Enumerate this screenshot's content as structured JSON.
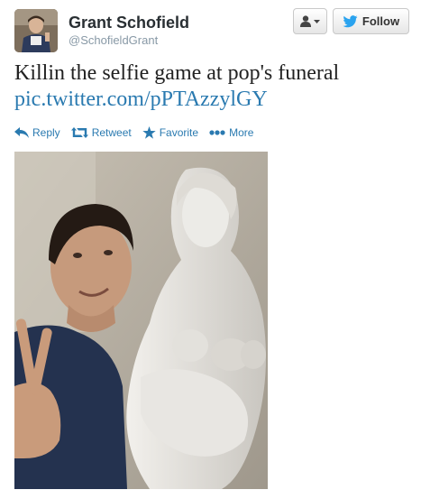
{
  "user": {
    "full_name": "Grant Schofield",
    "username": "@SchofieldGrant"
  },
  "header": {
    "user_dropdown_icon": "person-icon",
    "follow_label": "Follow",
    "follow_icon": "twitter-bird-icon"
  },
  "tweet": {
    "text": "Killin the selfie game at pop's funeral",
    "link": "pic.twitter.com/pPTAzzylGY"
  },
  "actions": {
    "reply": "Reply",
    "retweet": "Retweet",
    "favorite": "Favorite",
    "more": "More"
  },
  "colors": {
    "link": "#2a7ab0",
    "text": "#222222",
    "username": "#8899a6"
  }
}
